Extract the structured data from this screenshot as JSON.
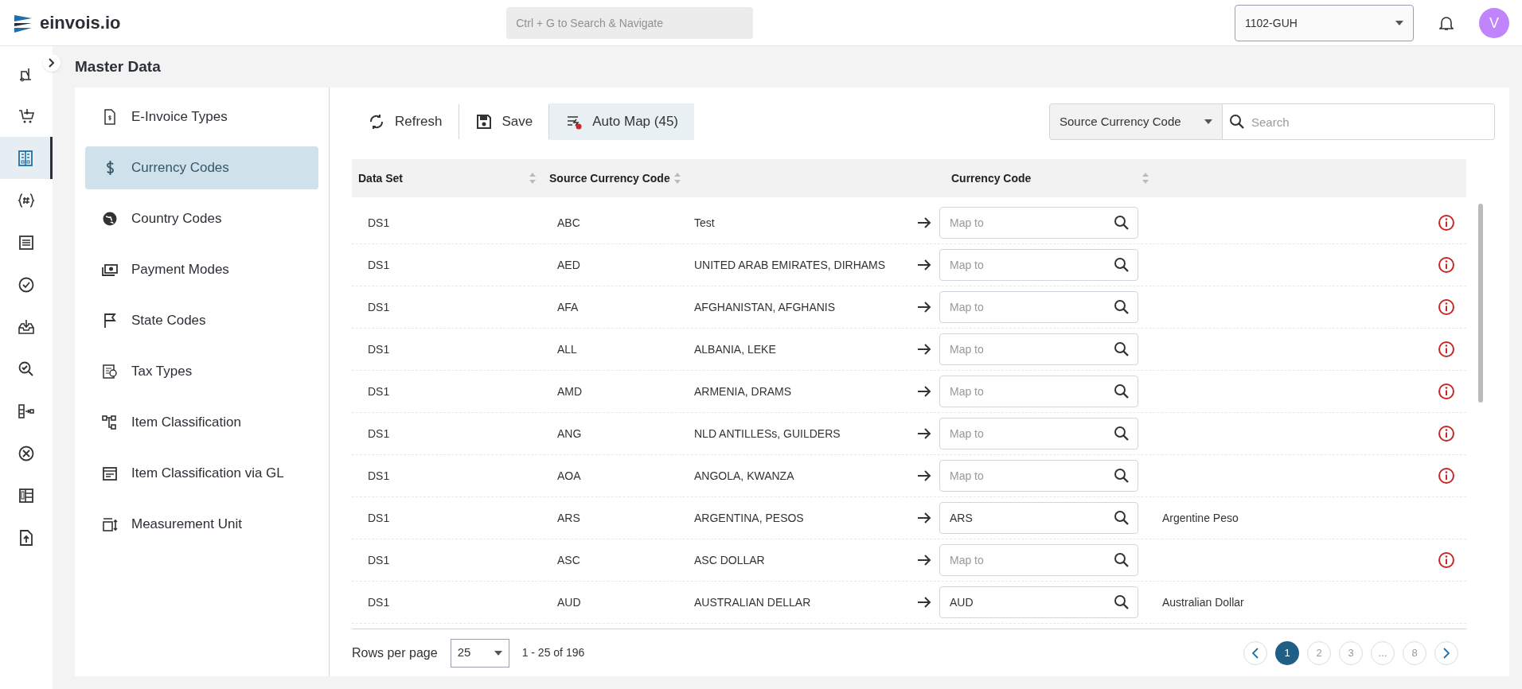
{
  "header": {
    "brand": "einvois.io",
    "search_placeholder": "Ctrl + G to Search & Navigate",
    "company": "1102-GUH",
    "avatar": "V"
  },
  "rail": [
    {
      "selected": false
    },
    {
      "selected": false
    },
    {
      "selected": true
    },
    {
      "selected": false
    },
    {
      "selected": false
    },
    {
      "selected": false
    },
    {
      "selected": false
    },
    {
      "selected": false
    },
    {
      "selected": false
    },
    {
      "selected": false
    },
    {
      "selected": false
    },
    {
      "selected": false
    }
  ],
  "page_title": "Master Data",
  "menu": [
    {
      "label": "E-Invoice Types",
      "selected": false
    },
    {
      "label": "Currency Codes",
      "selected": true
    },
    {
      "label": "Country Codes",
      "selected": false
    },
    {
      "label": "Payment Modes",
      "selected": false
    },
    {
      "label": "State Codes",
      "selected": false
    },
    {
      "label": "Tax Types",
      "selected": false
    },
    {
      "label": "Item Classification",
      "selected": false
    },
    {
      "label": "Item Classification via GL",
      "selected": false
    },
    {
      "label": "Measurement Unit",
      "selected": false
    }
  ],
  "toolbar": [
    {
      "label": "Refresh",
      "selected": false
    },
    {
      "label": "Save",
      "selected": false
    },
    {
      "label": "Auto Map (45)",
      "selected": true
    }
  ],
  "filter": {
    "field": "Source Currency Code",
    "placeholder": "Search"
  },
  "table": {
    "columns": [
      "Data Set",
      "Source Currency Code",
      "Currency Code"
    ],
    "rows": [
      {
        "data_set": "DS1",
        "code": "ABC",
        "description": "Test",
        "value": "",
        "placeholder": "Map to",
        "mapped_name": "",
        "warning": true
      },
      {
        "data_set": "DS1",
        "code": "AED",
        "description": "UNITED ARAB EMIRATES, DIRHAMS",
        "value": "",
        "placeholder": "Map to",
        "mapped_name": "",
        "warning": true
      },
      {
        "data_set": "DS1",
        "code": "AFA",
        "description": "AFGHANISTAN, AFGHANIS",
        "value": "",
        "placeholder": "Map to",
        "mapped_name": "",
        "warning": true
      },
      {
        "data_set": "DS1",
        "code": "ALL",
        "description": "ALBANIA, LEKE",
        "value": "",
        "placeholder": "Map to",
        "mapped_name": "",
        "warning": true
      },
      {
        "data_set": "DS1",
        "code": "AMD",
        "description": "ARMENIA, DRAMS",
        "value": "",
        "placeholder": "Map to",
        "mapped_name": "",
        "warning": true
      },
      {
        "data_set": "DS1",
        "code": "ANG",
        "description": "NLD ANTILLESs, GUILDERS",
        "value": "",
        "placeholder": "Map to",
        "mapped_name": "",
        "warning": true
      },
      {
        "data_set": "DS1",
        "code": "AOA",
        "description": "ANGOLA, KWANZA",
        "value": "",
        "placeholder": "Map to",
        "mapped_name": "",
        "warning": true
      },
      {
        "data_set": "DS1",
        "code": "ARS",
        "description": "ARGENTINA, PESOS",
        "value": "ARS",
        "mapped_name": "Argentine Peso",
        "warning": false
      },
      {
        "data_set": "DS1",
        "code": "ASC",
        "description": "ASC DOLLAR",
        "value": "",
        "placeholder": "Map to",
        "mapped_name": "",
        "warning": true
      },
      {
        "data_set": "DS1",
        "code": "AUD",
        "description": "AUSTRALIAN DELLAR",
        "value": "AUD",
        "mapped_name": "Australian Dollar",
        "warning": false
      }
    ]
  },
  "footer": {
    "rows_label": "Rows per page",
    "rows_value": "25",
    "range": "1 - 25 of 196",
    "pages": [
      {
        "label": "1",
        "selected": true
      },
      {
        "label": "2",
        "selected": false
      },
      {
        "label": "3",
        "selected": false
      },
      {
        "label": "...",
        "selected": false
      },
      {
        "label": "8",
        "selected": false
      }
    ]
  }
}
